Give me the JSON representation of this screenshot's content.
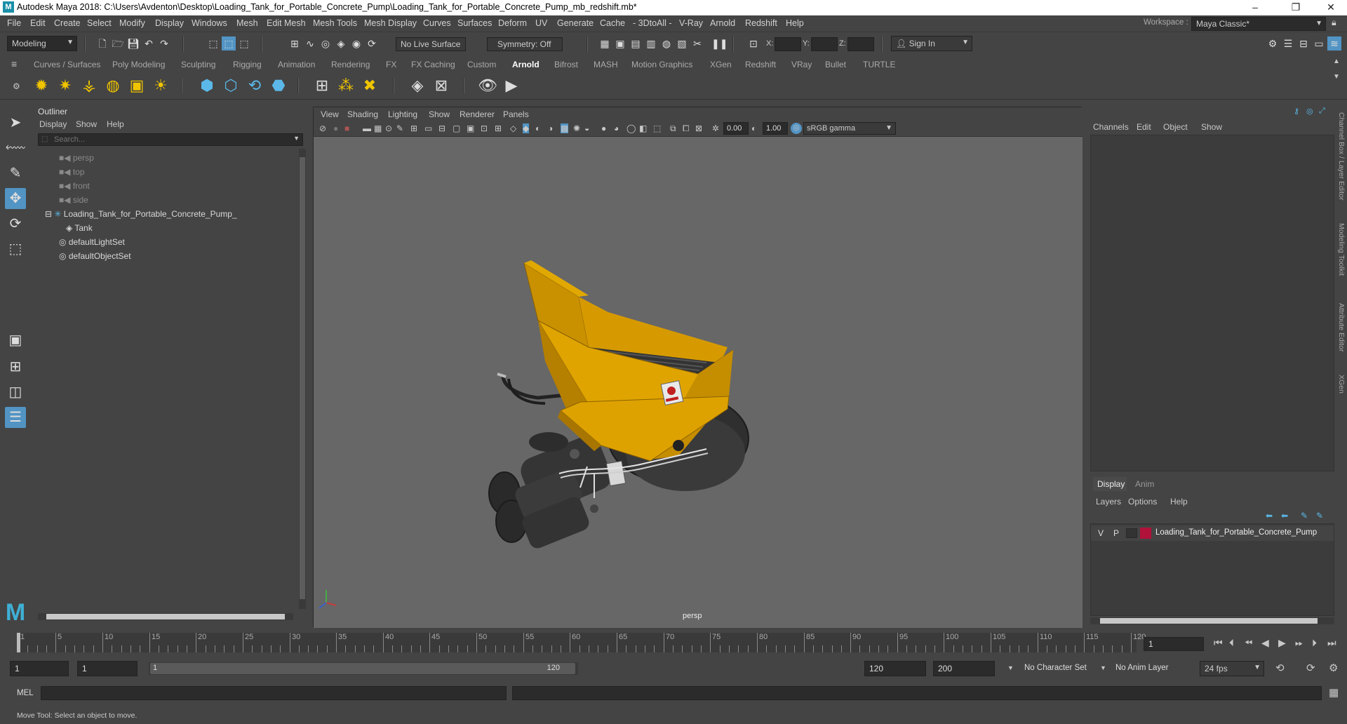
{
  "window": {
    "title": "Autodesk Maya 2018: C:\\Users\\Avdenton\\Desktop\\Loading_Tank_for_Portable_Concrete_Pump\\Loading_Tank_for_Portable_Concrete_Pump_mb_redshift.mb*",
    "minimize": "–",
    "maximize": "❐",
    "close": "✕"
  },
  "menu": [
    "File",
    "Edit",
    "Create",
    "Select",
    "Modify",
    "Display",
    "Windows",
    "Mesh",
    "Edit Mesh",
    "Mesh Tools",
    "Mesh Display",
    "Curves",
    "Surfaces",
    "Deform",
    "UV",
    "Generate",
    "Cache",
    "- 3DtoAll -",
    "V-Ray",
    "Arnold",
    "Redshift",
    "Help"
  ],
  "workspace": {
    "label": "Workspace :",
    "value": "Maya Classic*"
  },
  "status": {
    "mode": "Modeling",
    "live_surface": "No Live Surface",
    "symmetry": "Symmetry: Off",
    "x_label": "X:",
    "y_label": "Y:",
    "z_label": "Z:",
    "sign_in": "Sign In"
  },
  "shelf_tabs": [
    "Curves / Surfaces",
    "Poly Modeling",
    "Sculpting",
    "Rigging",
    "Animation",
    "Rendering",
    "FX",
    "FX Caching",
    "Custom",
    "Arnold",
    "Bifrost",
    "MASH",
    "Motion Graphics",
    "XGen",
    "Redshift",
    "VRay",
    "Bullet",
    "TURTLE"
  ],
  "active_shelf": "Arnold",
  "outliner": {
    "title": "Outliner",
    "menu": [
      "Display",
      "Show",
      "Help"
    ],
    "search_placeholder": "Search...",
    "items": [
      {
        "label": "persp",
        "dim": true
      },
      {
        "label": "top",
        "dim": true
      },
      {
        "label": "front",
        "dim": true
      },
      {
        "label": "side",
        "dim": true
      },
      {
        "label": "Loading_Tank_for_Portable_Concrete_Pump_",
        "dim": false
      },
      {
        "label": "Tank",
        "dim": false
      },
      {
        "label": "defaultLightSet",
        "dim": false
      },
      {
        "label": "defaultObjectSet",
        "dim": false
      }
    ]
  },
  "viewport": {
    "menu": [
      "View",
      "Shading",
      "Lighting",
      "Show",
      "Renderer",
      "Panels"
    ],
    "exposure": "0.00",
    "gamma": "1.00",
    "color_space": "sRGB gamma",
    "camera_label": "persp"
  },
  "channel_box": {
    "menu": [
      "Channels",
      "Edit",
      "Object",
      "Show"
    ],
    "side_tabs": [
      "Channel Box / Layer Editor",
      "Modeling Toolkit",
      "Attribute Editor",
      "XGen"
    ]
  },
  "layer_editor": {
    "tabs": [
      "Display",
      "Anim"
    ],
    "menu": [
      "Layers",
      "Options",
      "Help"
    ],
    "layer": {
      "v": "V",
      "p": "P",
      "name": "Loading_Tank_for_Portable_Concrete_Pump",
      "color": "#b0123a"
    }
  },
  "timeline": {
    "ticks": [
      1,
      5,
      10,
      15,
      20,
      25,
      30,
      35,
      40,
      45,
      50,
      55,
      60,
      65,
      70,
      75,
      80,
      85,
      90,
      95,
      100,
      105,
      110,
      115,
      120
    ],
    "current_frame": "1"
  },
  "range": {
    "start": "1",
    "playback_start": "1",
    "slider_start": "1",
    "slider_end": "120",
    "playback_end": "120",
    "end": "200",
    "character_set": "No Character Set",
    "anim_layer": "No Anim Layer",
    "fps": "24 fps"
  },
  "mel": {
    "label": "MEL"
  },
  "help_line": "Move Tool: Select an object to move."
}
